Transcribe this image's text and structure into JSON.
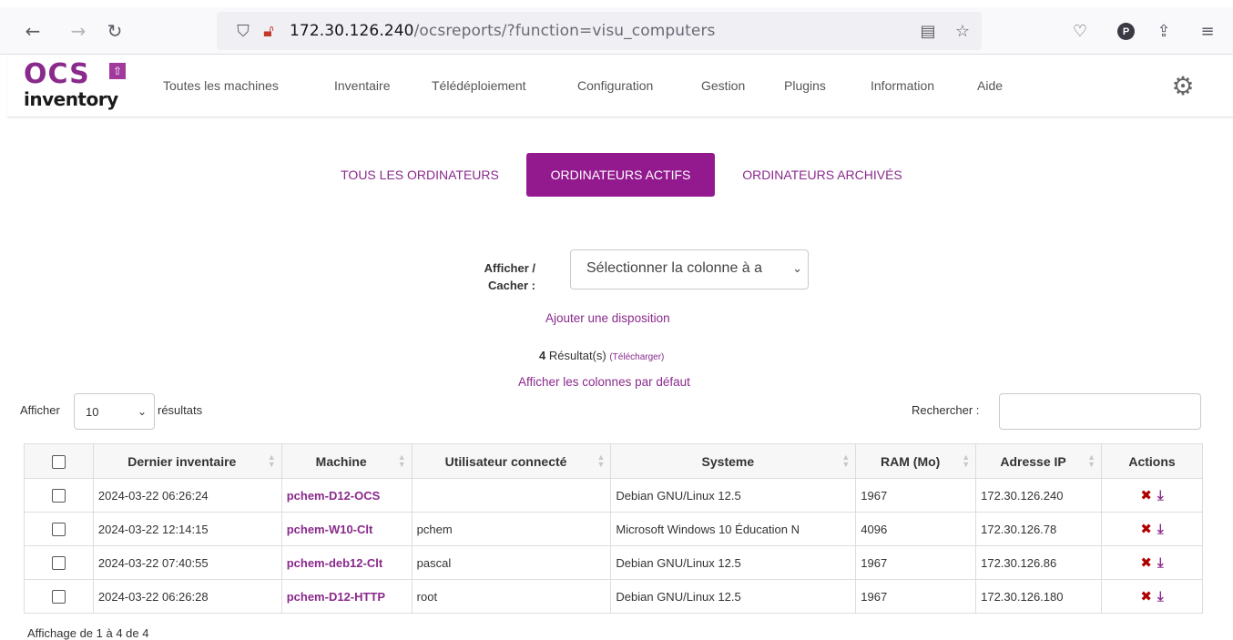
{
  "browser": {
    "url_host": "172.30.126.240",
    "url_path": "/ocsreports/?function=visu_computers",
    "icons": [
      "back-arrow-icon",
      "forward-arrow-icon",
      "reload-icon",
      "shield-icon",
      "insecure-lock-icon",
      "reader-view-icon",
      "bookmark-star-icon",
      "pocket-icon",
      "profile-icon",
      "share-icon",
      "hamburger-menu-icon"
    ],
    "profile_letter": "P"
  },
  "logo": {
    "ocs": "OCS",
    "inventory": "inventory"
  },
  "menu": [
    "Toutes les machines",
    "Inventaire",
    "Télédéploiement",
    "Configuration",
    "Gestion",
    "Plugins",
    "Information",
    "Aide"
  ],
  "tabs": [
    "TOUS LES ORDINATEURS",
    "ORDINATEURS ACTIFS",
    "ORDINATEURS ARCHIVÉS"
  ],
  "active_tab": "ORDINATEURS ACTIFS",
  "picker": {
    "label": "Afficher / Cacher :",
    "placeholder": "Sélectionner la colonne à a"
  },
  "add_layout_link": "Ajouter une disposition",
  "results": {
    "count": "4",
    "label": "Résultat(s)",
    "download": "(Télécharger)"
  },
  "default_columns_link": "Afficher les colonnes par défaut",
  "length": {
    "prefix": "Afficher",
    "value": "10",
    "suffix": "résultats"
  },
  "search": {
    "label": "Rechercher :",
    "value": ""
  },
  "table": {
    "headers": [
      "Dernier inventaire",
      "Machine",
      "Utilisateur connecté",
      "Systeme",
      "RAM (Mo)",
      "Adresse IP",
      "Actions"
    ],
    "rows": [
      {
        "date": "2024-03-22 06:26:24",
        "machine": "pchem-D12-OCS",
        "user": "",
        "os": "Debian GNU/Linux 12.5",
        "ram": "1967",
        "ip": "172.30.126.240"
      },
      {
        "date": "2024-03-22 12:14:15",
        "machine": "pchem-W10-Clt",
        "user": "pchem",
        "os": "Microsoft Windows 10 Éducation N",
        "ram": "4096",
        "ip": "172.30.126.78"
      },
      {
        "date": "2024-03-22 07:40:55",
        "machine": "pchem-deb12-Clt",
        "user": "pascal",
        "os": "Debian GNU/Linux 12.5",
        "ram": "1967",
        "ip": "172.30.126.86"
      },
      {
        "date": "2024-03-22 06:26:28",
        "machine": "pchem-D12-HTTP",
        "user": "root",
        "os": "Debian GNU/Linux 12.5",
        "ram": "1967",
        "ip": "172.30.126.180"
      }
    ]
  },
  "footer_info": "Affichage de 1 à 4 de 4",
  "colors": {
    "brand": "#931a8e",
    "link": "#8a2a8c",
    "delete": "#b00000"
  }
}
